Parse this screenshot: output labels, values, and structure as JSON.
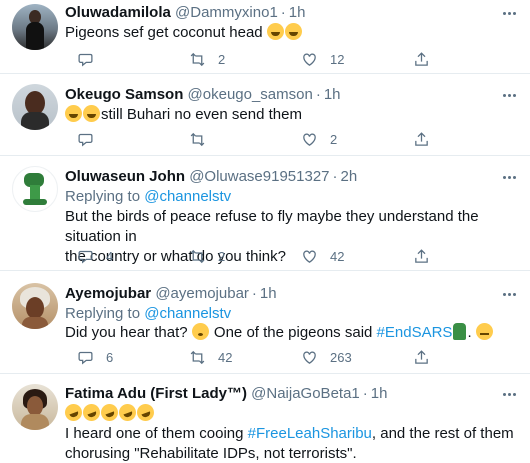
{
  "tweets": [
    {
      "name": "Oluwadamilola",
      "handle": "@Dammyxino1",
      "time": "1h",
      "text": "Pigeons sef get coconut head",
      "emojis": [
        "face-with-tears-of-joy",
        "face-with-tears-of-joy"
      ],
      "reply": "",
      "retweet": "2",
      "like": "12"
    },
    {
      "name": "Okeugo Samson",
      "handle": "@okeugo_samson",
      "time": "1h",
      "text_after": "still Buhari no even send them",
      "emojis": [
        "grinning-face-with-sweat",
        "grinning-face-with-sweat"
      ],
      "reply": "",
      "retweet": "",
      "like": "2"
    },
    {
      "name": "Oluwaseun John",
      "handle": "@Oluwase91951327",
      "time": "2h",
      "replying_label": "Replying to",
      "replying_handle": "@channelstv",
      "text_line1": "But the birds of peace refuse to fly maybe they understand the situation in",
      "text_line2": "the country or what do you think?",
      "reply": "4",
      "retweet": "2",
      "like": "42"
    },
    {
      "name": "Ayemojubar",
      "handle": "@ayemojubar",
      "time": "1h",
      "replying_label": "Replying to",
      "replying_handle": "@channelstv",
      "text_a": "Did you hear that?",
      "text_b": "One of the pigeons said",
      "hashtag": "#EndSARS",
      "text_c": ".",
      "emojis": [
        "flushed-face",
        "raised-fist-dark",
        "expressionless-face"
      ],
      "reply": "6",
      "retweet": "42",
      "like": "263"
    },
    {
      "name": "Fatima Adu (First Lady™)",
      "handle": "@NaijaGoBeta1",
      "time": "1h",
      "emojis": [
        "rolling-on-floor-laughing",
        "rolling-on-floor-laughing",
        "rolling-on-floor-laughing",
        "rolling-on-floor-laughing",
        "rolling-on-floor-laughing"
      ],
      "text_a": "I heard one of them cooing",
      "hashtag": "#FreeLeahSharibu",
      "text_b": ", and the rest of them",
      "text_line2": "chorusing \"Rehabilitate IDPs, not terrorists\"."
    }
  ],
  "colors": {
    "link": "#1b95e0",
    "secondary": "#5b7083",
    "divider": "#e6ecf0"
  },
  "icons": [
    "reply-icon",
    "retweet-icon",
    "like-icon",
    "share-icon",
    "more-icon"
  ]
}
